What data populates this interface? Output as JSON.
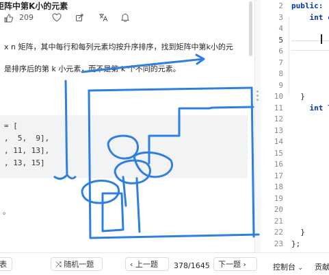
{
  "problem": {
    "title": "矩阵中第K小的元素",
    "likes": "209",
    "desc_line1_prefix": "x n 矩阵，其中每行和每列元素均按升序排序，找到矩阵中第k小的元",
    "desc_line2": "是排序后的第 k 小元素，而不是第 k 个不同的元素。",
    "example_lines": [
      "= [",
      ",  5,  9],",
      ", 11, 13],",
      ", 13, 15]"
    ],
    "footnote": "。"
  },
  "editor": {
    "line_numbers": [
      "2",
      "3",
      "4",
      "5",
      "6",
      "7",
      "8",
      "9",
      "10",
      "11",
      "12",
      "13",
      "14",
      "15",
      "16",
      "17",
      "18",
      "19",
      "20",
      "21",
      "22",
      "23"
    ],
    "active_line": "5",
    "code_lines": [
      {
        "line": "2",
        "text": "public:",
        "kw": true
      },
      {
        "line": "3",
        "text": "    int c",
        "kw": true
      },
      {
        "line": "10",
        "text": "  }",
        "kw": false
      },
      {
        "line": "11",
        "text": "    int l",
        "kw": true
      },
      {
        "line": "22",
        "text": "  }",
        "kw": false
      },
      {
        "line": "23",
        "text": "};",
        "kw": false
      }
    ]
  },
  "bottom_bar": {
    "left_label": "表",
    "random_label": "随机一题",
    "prev_label": "上一题",
    "page_counter": "378/1645",
    "next_label": "下一题",
    "console_label": "控制台",
    "contribute_label": "贡献"
  },
  "colors": {
    "ink": "#2f7fe0",
    "keyword": "#0033b3"
  }
}
